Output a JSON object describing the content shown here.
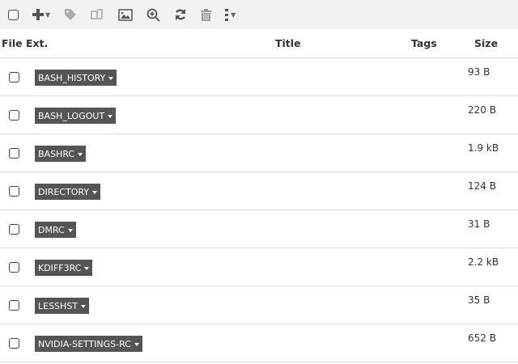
{
  "toolbar": {
    "icons": [
      "checkbox",
      "plus-icon",
      "tag-icon",
      "copy-icon",
      "image-icon",
      "zoom-in-icon",
      "refresh-icon",
      "trash-icon",
      "more-icon"
    ]
  },
  "table": {
    "headers": {
      "ext": "File Ext.",
      "title": "Title",
      "tags": "Tags",
      "size": "Size"
    },
    "rows": [
      {
        "ext": "BASH_HISTORY",
        "size": "93 B"
      },
      {
        "ext": "BASH_LOGOUT",
        "size": "220 B"
      },
      {
        "ext": "BASHRC",
        "size": "1.9 kB"
      },
      {
        "ext": "DIRECTORY",
        "size": "124 B"
      },
      {
        "ext": "DMRC",
        "size": "31 B"
      },
      {
        "ext": "KDIFF3RC",
        "size": "2.2 kB"
      },
      {
        "ext": "LESSHST",
        "size": "35 B"
      },
      {
        "ext": "NVIDIA-SETTINGS-RC",
        "size": "652 B"
      }
    ]
  }
}
